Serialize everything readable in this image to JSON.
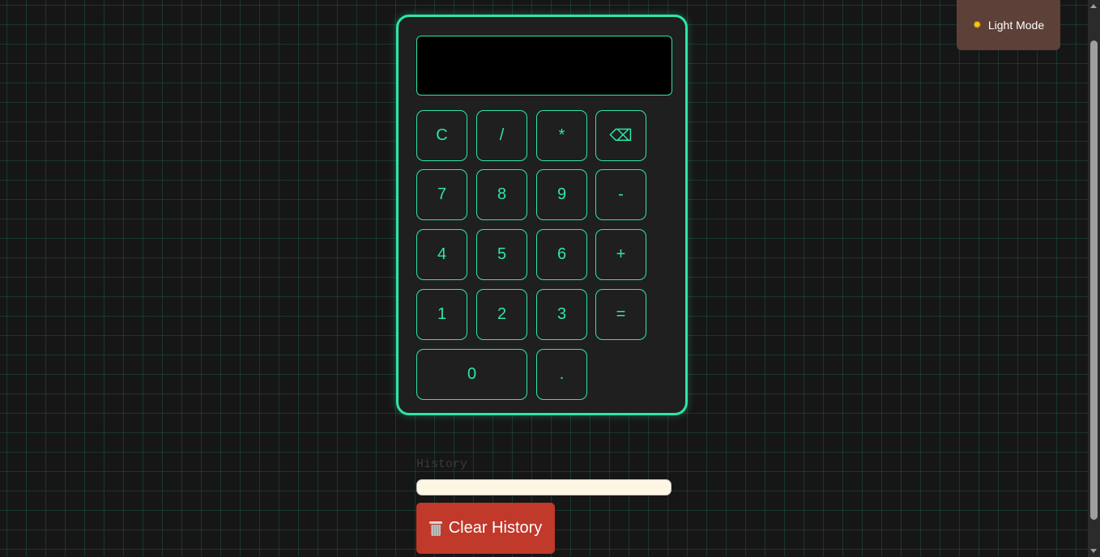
{
  "theme_toggle": {
    "icon": "sun-icon",
    "label": "Light Mode"
  },
  "calculator": {
    "display": "",
    "keys": {
      "clear": "C",
      "divide": "/",
      "multiply": "*",
      "backspace": "⌫",
      "seven": "7",
      "eight": "8",
      "nine": "9",
      "minus": "-",
      "four": "4",
      "five": "5",
      "six": "6",
      "plus": "+",
      "one": "1",
      "two": "2",
      "three": "3",
      "equals": "=",
      "zero": "0",
      "decimal": "."
    }
  },
  "history": {
    "title": "History",
    "items": [],
    "clear_label": "Clear History",
    "clear_icon": "trash-icon"
  },
  "colors": {
    "accent": "#2ee6a6",
    "background": "#161616",
    "toggle_bg": "#5d4037",
    "danger": "#c0392b"
  }
}
